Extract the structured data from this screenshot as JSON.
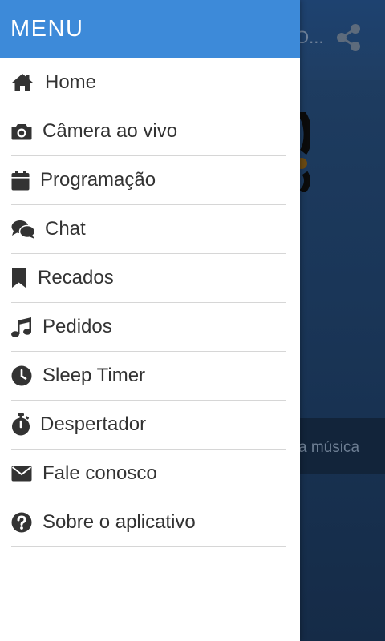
{
  "background": {
    "title_partial": "O...",
    "share_icon": "share-icon",
    "strip_text_partial": "a música"
  },
  "drawer": {
    "title": "MENU",
    "header_color": "#3d8ad9",
    "items": [
      {
        "label": "Home",
        "icon": "home-icon"
      },
      {
        "label": "Câmera ao vivo",
        "icon": "camera-icon"
      },
      {
        "label": "Programação",
        "icon": "calendar-icon"
      },
      {
        "label": "Chat",
        "icon": "chat-icon"
      },
      {
        "label": "Recados",
        "icon": "bookmark-icon"
      },
      {
        "label": "Pedidos",
        "icon": "music-icon"
      },
      {
        "label": "Sleep Timer",
        "icon": "clock-icon"
      },
      {
        "label": "Despertador",
        "icon": "stopwatch-icon"
      },
      {
        "label": "Fale conosco",
        "icon": "envelope-icon"
      },
      {
        "label": "Sobre o aplicativo",
        "icon": "question-icon"
      }
    ]
  }
}
